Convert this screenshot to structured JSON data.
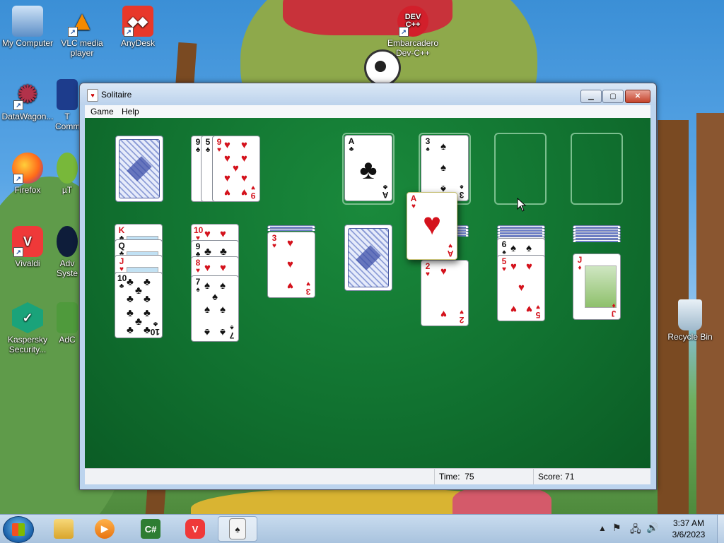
{
  "desktop": {
    "icons": [
      {
        "label": "My Computer"
      },
      {
        "label": "VLC media player"
      },
      {
        "label": "AnyDesk"
      },
      {
        "label": "Embarcadero Dev-C++"
      },
      {
        "label": "DataWagon..."
      },
      {
        "label": "T Comm"
      },
      {
        "label": "Firefox"
      },
      {
        "label": "µT"
      },
      {
        "label": "Vivaldi"
      },
      {
        "label": "Adv Syste"
      },
      {
        "label": "Kaspersky Security..."
      },
      {
        "label": "AdC"
      },
      {
        "label": "Recycle Bin"
      }
    ],
    "devcpp_logo": "DEV C++"
  },
  "window": {
    "title": "Solitaire",
    "menu": [
      "Game",
      "Help"
    ],
    "status": {
      "time_label": "Time:",
      "time_value": "75",
      "score_label": "Score:",
      "score_value": "71"
    }
  },
  "game": {
    "stock": "face-down",
    "waste": [
      {
        "rank": "9",
        "suit": "♣",
        "color": "black"
      },
      {
        "rank": "5",
        "suit": "♣",
        "color": "black"
      },
      {
        "rank": "9",
        "suit": "♥",
        "color": "red"
      }
    ],
    "foundations": [
      {
        "rank": "A",
        "suit": "♣",
        "color": "black"
      },
      {
        "rank": "3",
        "suit": "♠",
        "color": "black"
      },
      {
        "rank": "",
        "suit": "",
        "color": ""
      },
      {
        "rank": "",
        "suit": "",
        "color": ""
      }
    ],
    "dragging_card": {
      "rank": "A",
      "suit": "♥",
      "color": "red"
    },
    "tableau": [
      {
        "hidden": 0,
        "cards": [
          {
            "rank": "K",
            "suit": "♣",
            "color": "black"
          },
          {
            "rank": "Q",
            "suit": "♣",
            "color": "black"
          },
          {
            "rank": "J",
            "suit": "♥",
            "color": "red"
          },
          {
            "rank": "10",
            "suit": "♣",
            "color": "black"
          }
        ]
      },
      {
        "hidden": 0,
        "cards": [
          {
            "rank": "10",
            "suit": "♥",
            "color": "red"
          },
          {
            "rank": "9",
            "suit": "♣",
            "color": "black"
          },
          {
            "rank": "8",
            "suit": "♥",
            "color": "red"
          },
          {
            "rank": "7",
            "suit": "♠",
            "color": "black"
          }
        ]
      },
      {
        "hidden": 2,
        "cards": [
          {
            "rank": "3",
            "suit": "♥",
            "color": "red"
          }
        ]
      },
      {
        "hidden": 0,
        "cards": []
      },
      {
        "hidden": 4,
        "cards": [
          {
            "rank": "2",
            "suit": "♥",
            "color": "red"
          }
        ]
      },
      {
        "hidden": 5,
        "cards": [
          {
            "rank": "6",
            "suit": "♠",
            "color": "black"
          },
          {
            "rank": "5",
            "suit": "♥",
            "color": "red"
          }
        ]
      },
      {
        "hidden": 6,
        "cards": [
          {
            "rank": "J",
            "suit": "♦",
            "color": "red"
          }
        ]
      }
    ]
  },
  "taskbar": {
    "apps": [
      "Explorer",
      "Media Player",
      "C# IDE",
      "Vivaldi",
      "Solitaire"
    ],
    "active": "Solitaire",
    "clock_time": "3:37 AM",
    "clock_date": "3/6/2023"
  }
}
